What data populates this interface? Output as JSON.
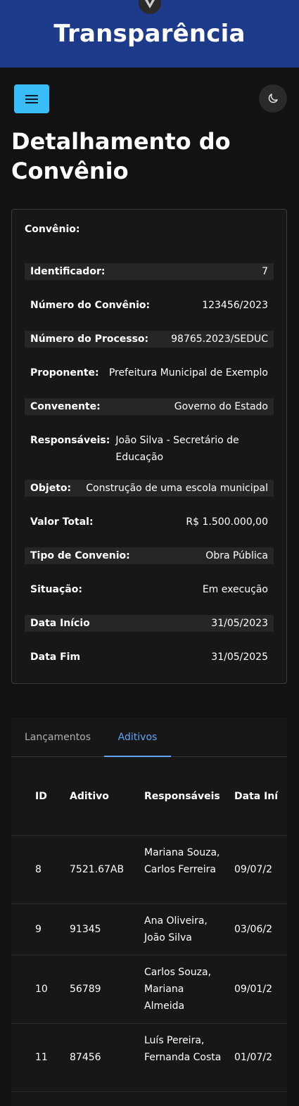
{
  "header": {
    "title": "Transparência"
  },
  "page": {
    "title": "Detalhamento do Convênio"
  },
  "convenio": {
    "heading": "Convênio:",
    "fields": [
      {
        "label": "Identificador:",
        "value": "7"
      },
      {
        "label": "Número do Convênio:",
        "value": "123456/2023"
      },
      {
        "label": "Número do Processo:",
        "value": "98765.2023/SEDUC"
      },
      {
        "label": "Proponente:",
        "value": "Prefeitura Municipal de Exemplo"
      },
      {
        "label": "Convenente:",
        "value": "Governo do Estado"
      },
      {
        "label": "Responsáveis:",
        "value": "João Silva - Secretário de Educação"
      },
      {
        "label": "Objeto:",
        "value": "Construção de uma escola municipal"
      },
      {
        "label": "Valor Total:",
        "value": "R$ 1.500.000,00"
      },
      {
        "label": "Tipo de Convenio:",
        "value": "Obra Pública"
      },
      {
        "label": "Situação:",
        "value": "Em execução"
      },
      {
        "label": "Data Início",
        "value": "31/05/2023"
      },
      {
        "label": "Data Fim",
        "value": "31/05/2025"
      }
    ]
  },
  "tabs": [
    {
      "label": "Lançamentos"
    },
    {
      "label": "Aditivos"
    }
  ],
  "aditivos_table": {
    "columns": [
      "ID",
      "Aditivo",
      "Responsáveis",
      "Data Iní"
    ],
    "rows": [
      {
        "id": "8",
        "aditivo": "7521.67AB",
        "responsaveis": "Mariana Souza, Carlos Ferreira",
        "data": "09/07/2"
      },
      {
        "id": "9",
        "aditivo": "91345",
        "responsaveis": "Ana Oliveira, João Silva",
        "data": "03/06/2"
      },
      {
        "id": "10",
        "aditivo": "56789",
        "responsaveis": "Carlos Souza, Mariana Almeida",
        "data": "09/01/2"
      },
      {
        "id": "11",
        "aditivo": "87456",
        "responsaveis": "Luís Pereira, Fernanda Costa",
        "data": "01/07/2"
      }
    ]
  },
  "colors": {
    "header_bg": "#1e3a8a",
    "page_bg": "#121212",
    "menu_button": "#38bdf8",
    "active_tab": "#60a5fa"
  },
  "icons": {
    "logo": "vuetify-logo-icon",
    "menu": "hamburger-menu-icon",
    "theme": "moon-icon"
  }
}
